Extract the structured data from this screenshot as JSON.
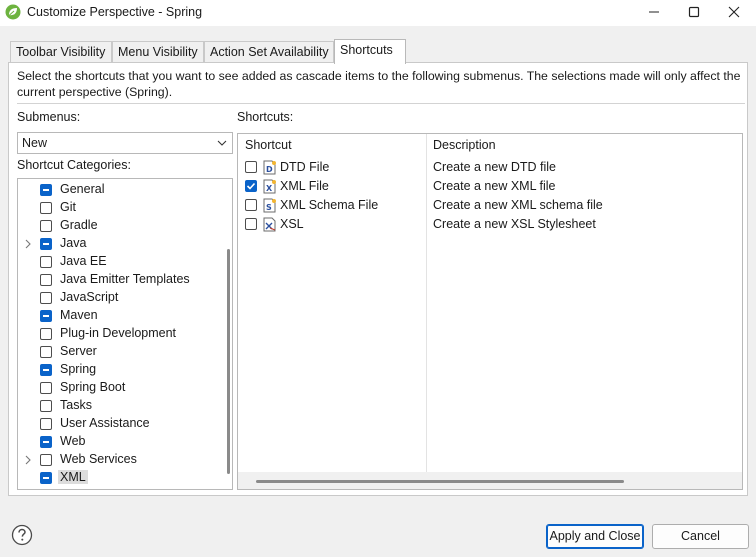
{
  "window": {
    "title": "Customize Perspective - Spring",
    "icon": "spring-leaf-icon",
    "accent": "#0a63c9"
  },
  "tabs": [
    {
      "label": "Toolbar Visibility",
      "active": false
    },
    {
      "label": "Menu Visibility",
      "active": false
    },
    {
      "label": "Action Set Availability",
      "active": false
    },
    {
      "label": "Shortcuts",
      "active": true
    }
  ],
  "description": "Select the shortcuts that you want to see added as cascade items to the following submenus. The selections made will only affect the current perspective (Spring).",
  "submenus": {
    "label": "Submenus:",
    "value": "New"
  },
  "categories": {
    "label": "Shortcut Categories:",
    "items": [
      {
        "label": "General",
        "state": "partial",
        "expandable": false
      },
      {
        "label": "Git",
        "state": "unchecked",
        "expandable": false
      },
      {
        "label": "Gradle",
        "state": "unchecked",
        "expandable": false
      },
      {
        "label": "Java",
        "state": "partial",
        "expandable": true
      },
      {
        "label": "Java EE",
        "state": "unchecked",
        "expandable": false
      },
      {
        "label": "Java Emitter Templates",
        "state": "unchecked",
        "expandable": false
      },
      {
        "label": "JavaScript",
        "state": "unchecked",
        "expandable": false
      },
      {
        "label": "Maven",
        "state": "partial",
        "expandable": false
      },
      {
        "label": "Plug-in Development",
        "state": "unchecked",
        "expandable": false
      },
      {
        "label": "Server",
        "state": "unchecked",
        "expandable": false
      },
      {
        "label": "Spring",
        "state": "partial",
        "expandable": false
      },
      {
        "label": "Spring Boot",
        "state": "unchecked",
        "expandable": false
      },
      {
        "label": "Tasks",
        "state": "unchecked",
        "expandable": false
      },
      {
        "label": "User Assistance",
        "state": "unchecked",
        "expandable": false
      },
      {
        "label": "Web",
        "state": "partial",
        "expandable": false
      },
      {
        "label": "Web Services",
        "state": "unchecked",
        "expandable": true
      },
      {
        "label": "XML",
        "state": "partial",
        "expandable": false,
        "selected": true
      }
    ]
  },
  "shortcuts": {
    "label": "Shortcuts:",
    "columns": [
      "Shortcut",
      "Description"
    ],
    "rows": [
      {
        "name": "DTD File",
        "description": "Create a new DTD file",
        "checked": false,
        "icon": "dtd-file-icon"
      },
      {
        "name": "XML File",
        "description": "Create a new XML file",
        "checked": true,
        "icon": "xml-file-icon"
      },
      {
        "name": "XML Schema File",
        "description": "Create a new XML schema file",
        "checked": false,
        "icon": "xml-schema-file-icon"
      },
      {
        "name": "XSL",
        "description": "Create a new XSL Stylesheet",
        "checked": false,
        "icon": "xsl-file-icon"
      }
    ]
  },
  "buttons": {
    "apply": "Apply and Close",
    "cancel": "Cancel"
  }
}
